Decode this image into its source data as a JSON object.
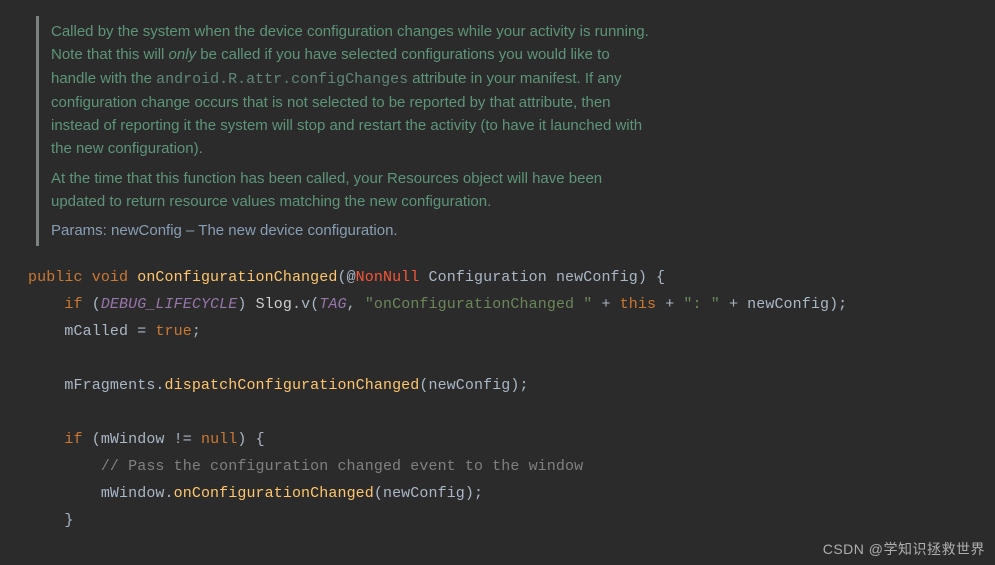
{
  "doc": {
    "p1a": "Called by the system when the device configuration changes while your activity is running. Note that this will ",
    "p1em": "only",
    "p1b": " be called if you have selected configurations you would like to handle with the ",
    "p1mono": "android.R.attr.configChanges",
    "p1c": " attribute in your manifest. If any configuration change occurs that is not selected to be reported by that attribute, then instead of reporting it the system will stop and restart the activity (to have it launched with the new configuration).",
    "p2": "At the time that this function has been called, your Resources object will have been updated to return resource values matching the new configuration.",
    "params": "Params: newConfig – The new device configuration."
  },
  "code": {
    "kw_public": "public",
    "kw_void": "void",
    "method": "onConfigurationChanged",
    "anno": "NonNull",
    "type_cfg": "Configuration",
    "param": "newConfig",
    "kw_if": "if",
    "const_debug": "DEBUG_LIFECYCLE",
    "slog": "Slog",
    "v": "v",
    "const_tag": "TAG",
    "str1": "\"onConfigurationChanged \"",
    "kw_this": "this",
    "str2": "\": \"",
    "mcalled": "mCalled",
    "kw_true": "true",
    "mfragments": "mFragments",
    "dispatch": "dispatchConfigurationChanged",
    "mwindow": "mWindow",
    "kw_null": "null",
    "comment": "// Pass the configuration changed event to the window",
    "oncfg": "onConfigurationChanged"
  },
  "watermark": "CSDN @学知识拯救世界"
}
